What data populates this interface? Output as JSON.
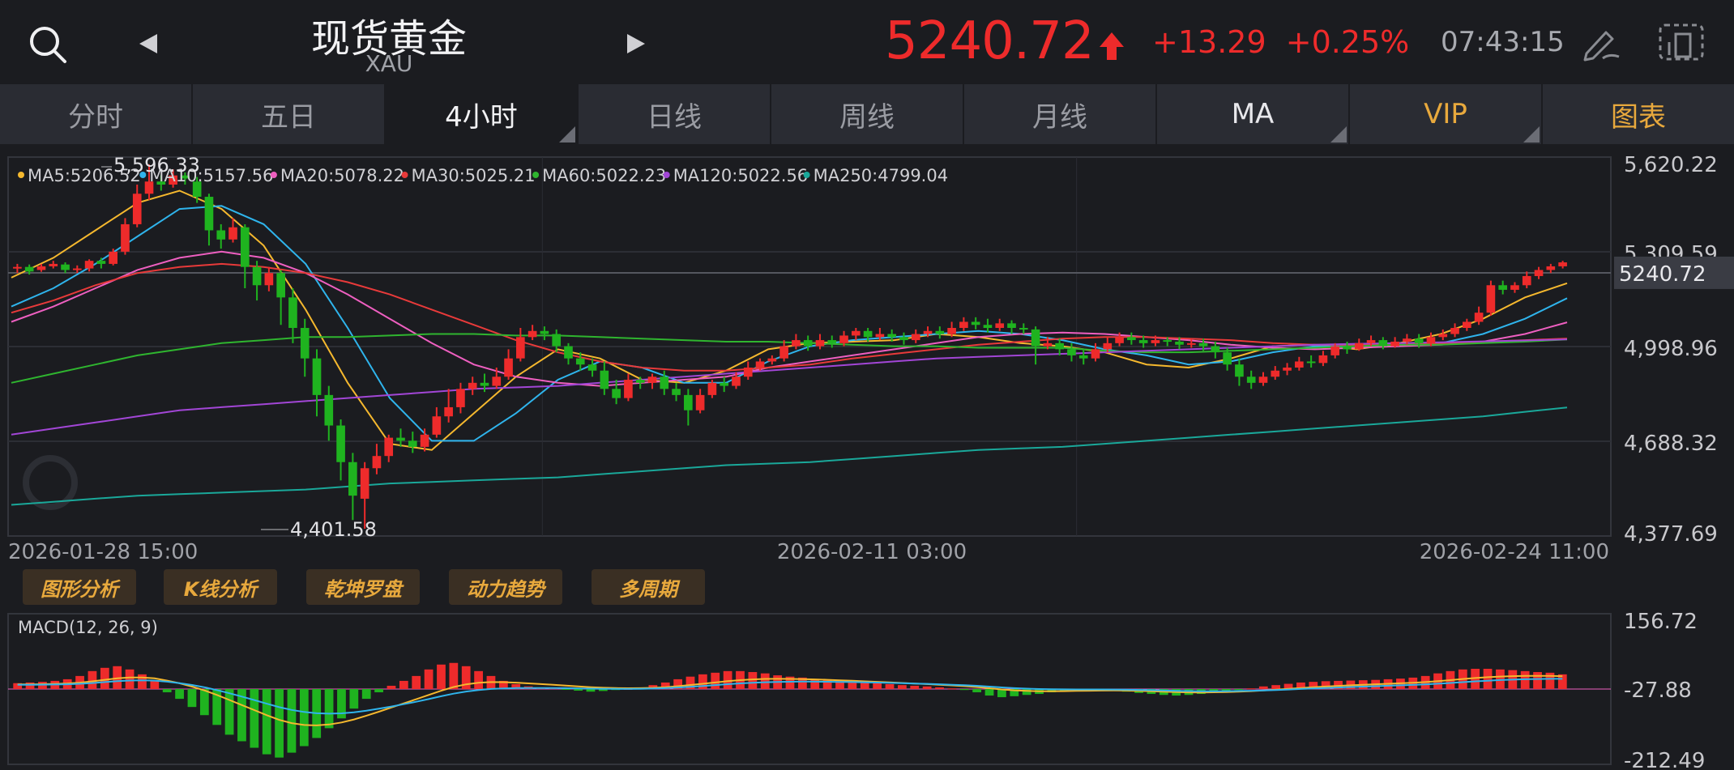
{
  "header": {
    "title": "现货黄金",
    "subtitle": "XAU",
    "price": "5240.72",
    "change": "+13.29",
    "change_pct": "+0.25%",
    "time": "07:43:15"
  },
  "tabs": [
    {
      "label": "分时",
      "active": false
    },
    {
      "label": "五日",
      "active": false
    },
    {
      "label": "4小时",
      "active": true
    },
    {
      "label": "日线",
      "active": false
    },
    {
      "label": "周线",
      "active": false
    },
    {
      "label": "月线",
      "active": false
    },
    {
      "label": "MA",
      "active": false
    },
    {
      "label": "VIP",
      "active": false
    },
    {
      "label": "图表",
      "active": false
    }
  ],
  "tools": [
    "图形分析",
    "K线分析",
    "乾坤罗盘",
    "动力趋势",
    "多周期"
  ],
  "colors": {
    "up": "#ee2b2b",
    "down": "#1fb31f",
    "accent": "#e8a93d",
    "bg": "#1b1c20"
  },
  "chart_data": [
    {
      "type": "candlestick",
      "ylim": [
        4377.69,
        5620.22
      ],
      "y_ticks": [
        "5,620.22",
        "5,309.59",
        "4,998.96",
        "4,688.32",
        "4,377.69"
      ],
      "current_price_label": "5240.72",
      "x_labels": [
        "2026-01-28 15:00",
        "2026-02-11 03:00",
        "2026-02-24 11:00"
      ],
      "high_label": "5,596.33",
      "low_label": "4,401.58",
      "legend": [
        {
          "name": "MA5:5206.52",
          "color": "#f5b82e"
        },
        {
          "name": "MA10:5157.56",
          "color": "#2fb4ec"
        },
        {
          "name": "MA20:5078.22",
          "color": "#ee5fc0"
        },
        {
          "name": "MA30:5025.21",
          "color": "#e83a3a"
        },
        {
          "name": "MA60:5022.23",
          "color": "#2fb52f"
        },
        {
          "name": "MA120:5022.56",
          "color": "#a246d6"
        },
        {
          "name": "MA250:4799.04",
          "color": "#1aa89a"
        }
      ],
      "candles": [
        [
          5255,
          5260,
          5240,
          5270
        ],
        [
          5260,
          5245,
          5235,
          5268
        ],
        [
          5250,
          5262,
          5244,
          5270
        ],
        [
          5262,
          5270,
          5255,
          5280
        ],
        [
          5268,
          5250,
          5240,
          5275
        ],
        [
          5250,
          5255,
          5240,
          5265
        ],
        [
          5255,
          5280,
          5245,
          5285
        ],
        [
          5280,
          5270,
          5255,
          5290
        ],
        [
          5270,
          5310,
          5265,
          5320
        ],
        [
          5310,
          5400,
          5300,
          5420
        ],
        [
          5400,
          5500,
          5390,
          5530
        ],
        [
          5500,
          5540,
          5480,
          5596.33
        ],
        [
          5540,
          5530,
          5510,
          5560
        ],
        [
          5530,
          5560,
          5520,
          5580
        ],
        [
          5560,
          5550,
          5530,
          5570
        ],
        [
          5540,
          5490,
          5470,
          5555
        ],
        [
          5490,
          5380,
          5330,
          5500
        ],
        [
          5380,
          5350,
          5320,
          5400
        ],
        [
          5350,
          5390,
          5340,
          5420
        ],
        [
          5390,
          5260,
          5190,
          5400
        ],
        [
          5260,
          5200,
          5150,
          5280
        ],
        [
          5200,
          5240,
          5180,
          5260
        ],
        [
          5240,
          5160,
          5070,
          5250
        ],
        [
          5160,
          5060,
          5010,
          5190
        ],
        [
          5060,
          4960,
          4900,
          5090
        ],
        [
          4960,
          4840,
          4770,
          4990
        ],
        [
          4840,
          4740,
          4690,
          4870
        ],
        [
          4740,
          4620,
          4560,
          4760
        ],
        [
          4620,
          4510,
          4430,
          4650
        ],
        [
          4500,
          4600,
          4401.58,
          4620
        ],
        [
          4600,
          4640,
          4580,
          4680
        ],
        [
          4640,
          4700,
          4620,
          4710
        ],
        [
          4700,
          4690,
          4670,
          4730
        ],
        [
          4690,
          4670,
          4650,
          4720
        ],
        [
          4670,
          4710,
          4655,
          4730
        ],
        [
          4710,
          4770,
          4700,
          4800
        ],
        [
          4770,
          4800,
          4750,
          4860
        ],
        [
          4800,
          4860,
          4780,
          4880
        ],
        [
          4860,
          4880,
          4840,
          4900
        ],
        [
          4880,
          4870,
          4850,
          4910
        ],
        [
          4870,
          4900,
          4860,
          4930
        ],
        [
          4900,
          4960,
          4890,
          4990
        ],
        [
          4960,
          5030,
          4950,
          5060
        ],
        [
          5030,
          5050,
          5020,
          5070
        ],
        [
          5050,
          5040,
          5020,
          5065
        ],
        [
          5040,
          5000,
          4980,
          5055
        ],
        [
          5000,
          4960,
          4940,
          5010
        ],
        [
          4960,
          4940,
          4920,
          4980
        ],
        [
          4940,
          4920,
          4900,
          4960
        ],
        [
          4920,
          4860,
          4840,
          4950
        ],
        [
          4860,
          4830,
          4810,
          4890
        ],
        [
          4830,
          4890,
          4820,
          4910
        ],
        [
          4890,
          4880,
          4860,
          4900
        ],
        [
          4880,
          4900,
          4860,
          4910
        ],
        [
          4900,
          4860,
          4840,
          4920
        ],
        [
          4860,
          4840,
          4820,
          4880
        ],
        [
          4840,
          4790,
          4740,
          4860
        ],
        [
          4790,
          4840,
          4780,
          4860
        ],
        [
          4840,
          4880,
          4830,
          4890
        ],
        [
          4880,
          4870,
          4850,
          4900
        ],
        [
          4870,
          4900,
          4860,
          4915
        ],
        [
          4900,
          4930,
          4890,
          4950
        ],
        [
          4930,
          4950,
          4920,
          4960
        ],
        [
          4950,
          4960,
          4940,
          4970
        ],
        [
          4960,
          5000,
          4950,
          5020
        ],
        [
          5000,
          5020,
          4990,
          5040
        ],
        [
          5020,
          5000,
          4985,
          5035
        ],
        [
          5000,
          5020,
          4990,
          5040
        ],
        [
          5020,
          5010,
          4995,
          5035
        ],
        [
          5010,
          5035,
          5000,
          5050
        ],
        [
          5035,
          5050,
          5020,
          5060
        ],
        [
          5050,
          5030,
          5015,
          5060
        ],
        [
          5030,
          5040,
          5020,
          5060
        ],
        [
          5040,
          5030,
          5015,
          5055
        ],
        [
          5030,
          5020,
          5005,
          5045
        ],
        [
          5020,
          5040,
          5010,
          5055
        ],
        [
          5040,
          5050,
          5030,
          5065
        ],
        [
          5050,
          5040,
          5025,
          5065
        ],
        [
          5040,
          5060,
          5030,
          5080
        ],
        [
          5060,
          5080,
          5050,
          5095
        ],
        [
          5080,
          5070,
          5055,
          5095
        ],
        [
          5070,
          5060,
          5045,
          5090
        ],
        [
          5060,
          5075,
          5050,
          5090
        ],
        [
          5075,
          5060,
          5040,
          5085
        ],
        [
          5060,
          5055,
          5040,
          5075
        ],
        [
          5055,
          5000,
          4940,
          5065
        ],
        [
          5000,
          5010,
          4990,
          5030
        ],
        [
          5010,
          4990,
          4970,
          5025
        ],
        [
          4990,
          4970,
          4950,
          5010
        ],
        [
          4970,
          4960,
          4940,
          4990
        ],
        [
          4960,
          4990,
          4950,
          5010
        ],
        [
          4990,
          5010,
          4980,
          5030
        ],
        [
          5010,
          5030,
          5000,
          5045
        ],
        [
          5030,
          5020,
          5005,
          5045
        ],
        [
          5020,
          5010,
          4995,
          5035
        ],
        [
          5010,
          5020,
          5000,
          5035
        ],
        [
          5020,
          5015,
          5000,
          5030
        ],
        [
          5015,
          5005,
          4990,
          5030
        ],
        [
          5005,
          5010,
          4995,
          5025
        ],
        [
          5010,
          5000,
          4985,
          5025
        ],
        [
          5000,
          4980,
          4960,
          5015
        ],
        [
          4980,
          4940,
          4920,
          4995
        ],
        [
          4940,
          4900,
          4870,
          4960
        ],
        [
          4900,
          4880,
          4860,
          4920
        ],
        [
          4880,
          4900,
          4870,
          4915
        ],
        [
          4900,
          4920,
          4890,
          4935
        ],
        [
          4920,
          4930,
          4905,
          4945
        ],
        [
          4930,
          4950,
          4920,
          4965
        ],
        [
          4950,
          4945,
          4930,
          4970
        ],
        [
          4945,
          4970,
          4935,
          4985
        ],
        [
          4970,
          5000,
          4960,
          5010
        ],
        [
          5000,
          4990,
          4975,
          5015
        ],
        [
          4990,
          5010,
          4985,
          5025
        ],
        [
          5010,
          5020,
          5000,
          5035
        ],
        [
          5020,
          5000,
          4990,
          5030
        ],
        [
          5000,
          5015,
          4995,
          5030
        ],
        [
          5015,
          5025,
          5005,
          5040
        ],
        [
          5025,
          5010,
          4995,
          5040
        ],
        [
          5010,
          5030,
          5000,
          5045
        ],
        [
          5030,
          5040,
          5020,
          5055
        ],
        [
          5040,
          5060,
          5030,
          5075
        ],
        [
          5060,
          5080,
          5050,
          5090
        ],
        [
          5080,
          5110,
          5070,
          5130
        ],
        [
          5110,
          5200,
          5100,
          5215
        ],
        [
          5200,
          5185,
          5170,
          5215
        ],
        [
          5185,
          5200,
          5175,
          5210
        ],
        [
          5200,
          5230,
          5190,
          5245
        ],
        [
          5230,
          5250,
          5220,
          5260
        ],
        [
          5250,
          5262,
          5240,
          5270
        ],
        [
          5262,
          5275,
          5255,
          5280
        ]
      ],
      "ma_lines": [
        {
          "name": "MA5",
          "color": "#f5b82e",
          "points": [
            5225,
            5290,
            5380,
            5470,
            5510,
            5450,
            5330,
            5120,
            4880,
            4680,
            4660,
            4780,
            4900,
            4990,
            4960,
            4890,
            4880,
            4920,
            4990,
            5010,
            5015,
            5020,
            5040,
            5030,
            5010,
            5000,
            4980,
            4940,
            4930,
            4960,
            5000,
            5005,
            4990,
            5010,
            5040,
            5090,
            5160,
            5206.52
          ]
        },
        {
          "name": "MA10",
          "color": "#2fb4ec",
          "points": [
            5130,
            5190,
            5270,
            5360,
            5450,
            5460,
            5400,
            5270,
            5060,
            4830,
            4690,
            4690,
            4780,
            4890,
            4950,
            4930,
            4880,
            4880,
            4950,
            5000,
            5020,
            5030,
            5040,
            5050,
            5040,
            5020,
            4990,
            4970,
            4940,
            4950,
            4980,
            5000,
            5000,
            5000,
            5010,
            5040,
            5090,
            5157.56
          ]
        }
      ]
    },
    {
      "type": "bar",
      "title": "MACD(12, 26, 9)",
      "y_ticks": [
        "156.72",
        "-27.88",
        "-212.49"
      ],
      "ylim": [
        -212.49,
        156.72
      ],
      "histogram": [
        18,
        20,
        22,
        25,
        30,
        40,
        55,
        65,
        70,
        60,
        45,
        25,
        -10,
        -30,
        -55,
        -80,
        -110,
        -140,
        -160,
        -180,
        -200,
        -210,
        -195,
        -175,
        -150,
        -120,
        -90,
        -60,
        -30,
        -10,
        10,
        25,
        40,
        60,
        75,
        80,
        70,
        55,
        40,
        25,
        15,
        8,
        5,
        3,
        -2,
        -5,
        -8,
        -6,
        -3,
        0,
        5,
        12,
        20,
        30,
        38,
        45,
        50,
        55,
        55,
        52,
        48,
        42,
        38,
        35,
        30,
        28,
        25,
        22,
        20,
        18,
        15,
        12,
        10,
        8,
        5,
        2,
        -3,
        -10,
        -20,
        -25,
        -22,
        -18,
        -15,
        -10,
        -6,
        -3,
        -2,
        -3,
        -5,
        -8,
        -12,
        -15,
        -18,
        -20,
        -18,
        -15,
        -10,
        -6,
        -3,
        2,
        8,
        12,
        16,
        20,
        22,
        24,
        25,
        26,
        27,
        28,
        30,
        32,
        35,
        40,
        48,
        55,
        60,
        62,
        62,
        60,
        58,
        55,
        52,
        50,
        45
      ]
    }
  ]
}
